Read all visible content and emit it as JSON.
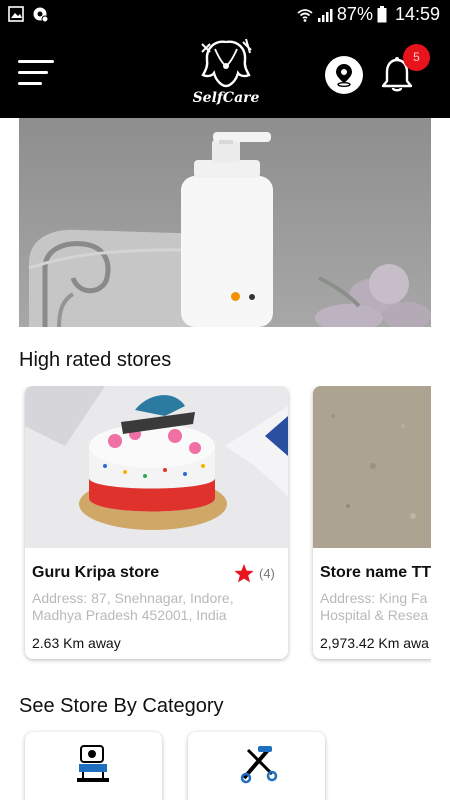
{
  "status_bar": {
    "battery": "87%",
    "time": "14:59",
    "left_icons": [
      "image-icon",
      "settings-notification-icon"
    ],
    "right_icons": [
      "wifi-icon",
      "signal-icon",
      "battery-icon"
    ]
  },
  "header": {
    "logo_text": "SelfCare",
    "menu_icon": "hamburger-menu-icon",
    "location_icon": "location-pin-icon",
    "notification_icon": "bell-icon",
    "notification_count": "5"
  },
  "banner": {
    "slides": 2,
    "active_slide": 1
  },
  "high_rated": {
    "title": "High rated stores",
    "stores": [
      {
        "name": "Guru Kripa store",
        "rating_count": "(4)",
        "address_line1": "Address: 87, Snehnagar, Indore,",
        "address_line2": "Madhya Pradesh 452001, India",
        "distance": "2.63 Km away"
      },
      {
        "name": "Store name TT",
        "address_line1": "Address: King Fa",
        "address_line2": "Hospital & Resea",
        "distance": "2,973.42 Km awa"
      }
    ]
  },
  "categories": {
    "title": "See Store By Category",
    "items": [
      {
        "icon": "salon-chair-icon"
      },
      {
        "icon": "grooming-tools-icon"
      }
    ]
  },
  "colors": {
    "header_bg": "#000000",
    "badge": "#e8141c",
    "star": "#e8141c",
    "active_dot": "#f39200"
  }
}
